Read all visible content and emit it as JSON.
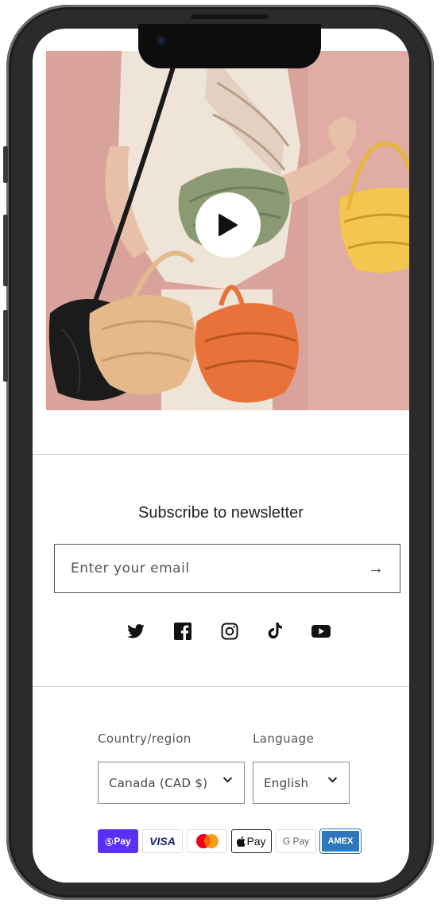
{
  "newsletter": {
    "title": "Subscribe to newsletter",
    "email_placeholder": "Enter your email",
    "submit_arrow": "→"
  },
  "social_icons": [
    "twitter-icon",
    "facebook-icon",
    "instagram-icon",
    "tiktok-icon",
    "youtube-icon"
  ],
  "localization": {
    "country_label": "Country/region",
    "country_value": "Canada (CAD $)",
    "language_label": "Language",
    "language_value": "English"
  },
  "payment": {
    "shop_pay": "Pay",
    "visa": "VISA",
    "apple_pay": "Pay",
    "google_pay": "G Pay",
    "amex": "AMEX"
  },
  "colors": {
    "video_background": "#d8a39b",
    "shop_pay": "#5a31f4",
    "visa": "#1a1f71",
    "amex": "#2e77bc"
  }
}
